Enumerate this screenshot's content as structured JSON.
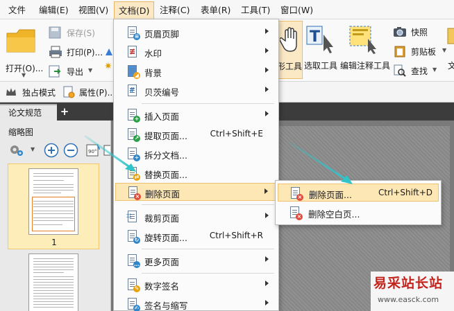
{
  "menubar": {
    "items": [
      "文件",
      "编辑(E)",
      "视图(V)",
      "文档(D)",
      "注释(C)",
      "表单(R)",
      "工具(T)",
      "窗口(W)"
    ]
  },
  "ribbon": {
    "open": "打开(O)...",
    "save": "保存(S)",
    "print": "打印(P)...",
    "export": "导出",
    "hand_tool": "形工具",
    "select_text_tool": "选取工具",
    "edit_annotation_tool": "编辑注释工具",
    "snapshot": "快照",
    "clipboard": "剪贴板",
    "find": "查找",
    "more": "文"
  },
  "subbar": {
    "exclusive_mode": "独占模式",
    "properties": "属性(P)..."
  },
  "tabs": {
    "doc_tab": "论文规范",
    "add": "+"
  },
  "thumbnails": {
    "title": "缩略图",
    "page1": "1"
  },
  "document_menu": {
    "items": [
      {
        "label": "页眉页脚",
        "shortcut": "",
        "submenu": true
      },
      {
        "label": "水印",
        "shortcut": "",
        "submenu": true
      },
      {
        "label": "背景",
        "shortcut": "",
        "submenu": true
      },
      {
        "label": "贝茨编号",
        "shortcut": "",
        "submenu": true
      },
      {
        "label": "插入页面",
        "shortcut": "",
        "submenu": true
      },
      {
        "label": "提取页面...",
        "shortcut": "Ctrl+Shift+E",
        "submenu": false
      },
      {
        "label": "拆分文档...",
        "shortcut": "",
        "submenu": false
      },
      {
        "label": "替换页面...",
        "shortcut": "",
        "submenu": false
      },
      {
        "label": "删除页面",
        "shortcut": "",
        "submenu": true
      },
      {
        "label": "裁剪页面",
        "shortcut": "",
        "submenu": true
      },
      {
        "label": "旋转页面...",
        "shortcut": "Ctrl+Shift+R",
        "submenu": false
      },
      {
        "label": "更多页面",
        "shortcut": "",
        "submenu": true
      },
      {
        "label": "数字签名",
        "shortcut": "",
        "submenu": true
      },
      {
        "label": "签名与缩写",
        "shortcut": "",
        "submenu": true
      }
    ]
  },
  "delete_submenu": {
    "items": [
      {
        "label": "删除页面...",
        "shortcut": "Ctrl+Shift+D"
      },
      {
        "label": "删除空白页..."
      }
    ]
  },
  "watermark": {
    "title": "易采站长站",
    "url": "www.easck.com"
  },
  "colors": {
    "highlight": "#fde7b4",
    "highlight_border": "#eec170",
    "arrow": "#2fc4c9",
    "watermark_red": "#c4231c"
  }
}
